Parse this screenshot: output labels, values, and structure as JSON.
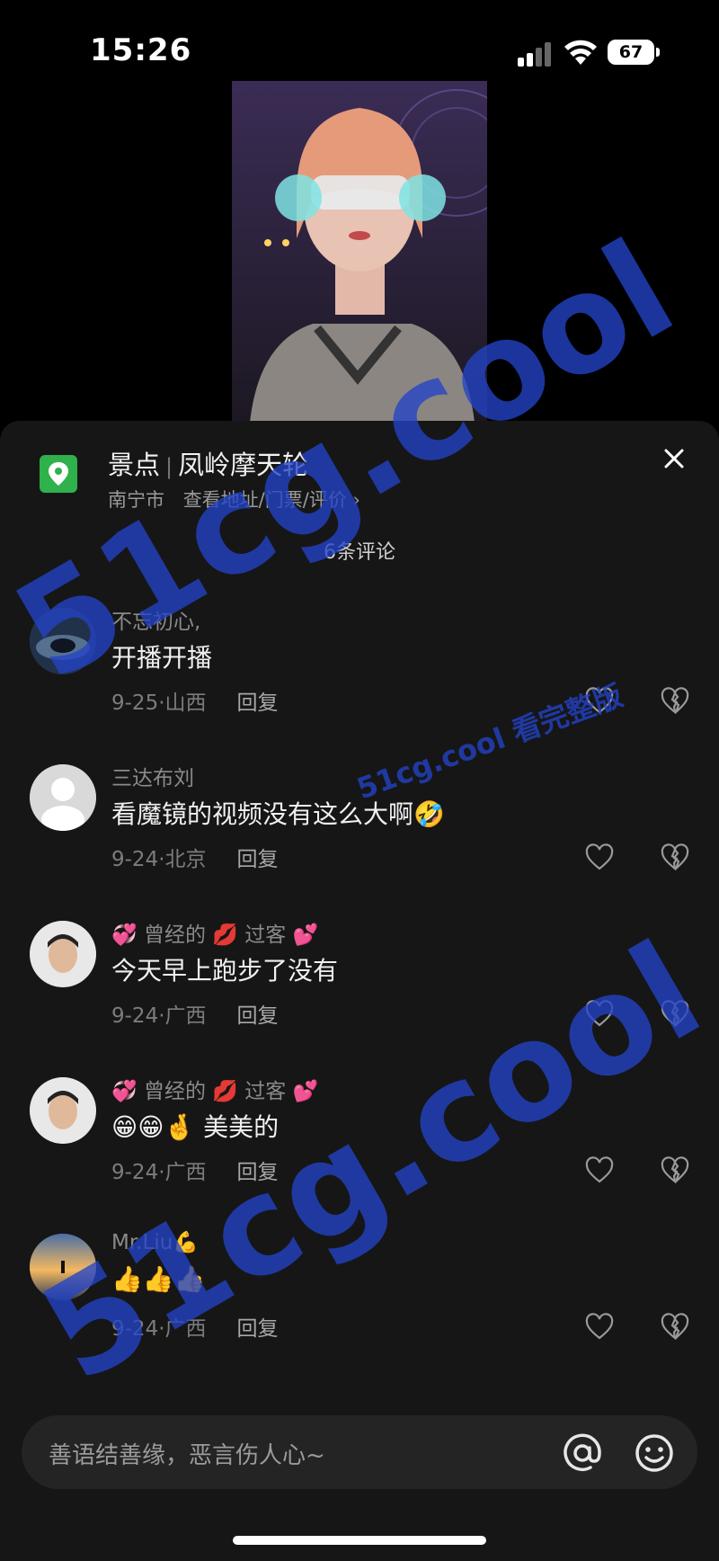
{
  "status_bar": {
    "time": "15:26",
    "battery": "67"
  },
  "location": {
    "category": "景点",
    "name": "凤岭摩天轮",
    "city": "南宁市",
    "link": "查看地址/门票/评价 ›"
  },
  "comment_count": "6条评论",
  "reply_label": "回复",
  "comments": [
    {
      "user": "不忘初心,",
      "text": "开播开播",
      "date": "9-25",
      "region": "山西"
    },
    {
      "user": "三达布刘",
      "text": "看魔镜的视频没有这么大啊🤣",
      "date": "9-24",
      "region": "北京"
    },
    {
      "user": "💞 曾经的 💋 过客 💕",
      "text": "今天早上跑步了没有",
      "date": "9-24",
      "region": "广西"
    },
    {
      "user": "💞 曾经的 💋 过客 💕",
      "text": "😁😁🤞 美美的",
      "date": "9-24",
      "region": "广西"
    },
    {
      "user": "Mr.Liu💪",
      "text": "👍👍👍",
      "date": "9-24",
      "region": "广西"
    }
  ],
  "input": {
    "placeholder": "善语结善缘，恶言伤人心~"
  },
  "watermark": {
    "big": "51cg.cool",
    "small": "51cg.cool 看完整版"
  },
  "colors": {
    "sheet_bg": "#161616",
    "location_icon": "#2fb14c",
    "watermark": "#2444c8"
  }
}
